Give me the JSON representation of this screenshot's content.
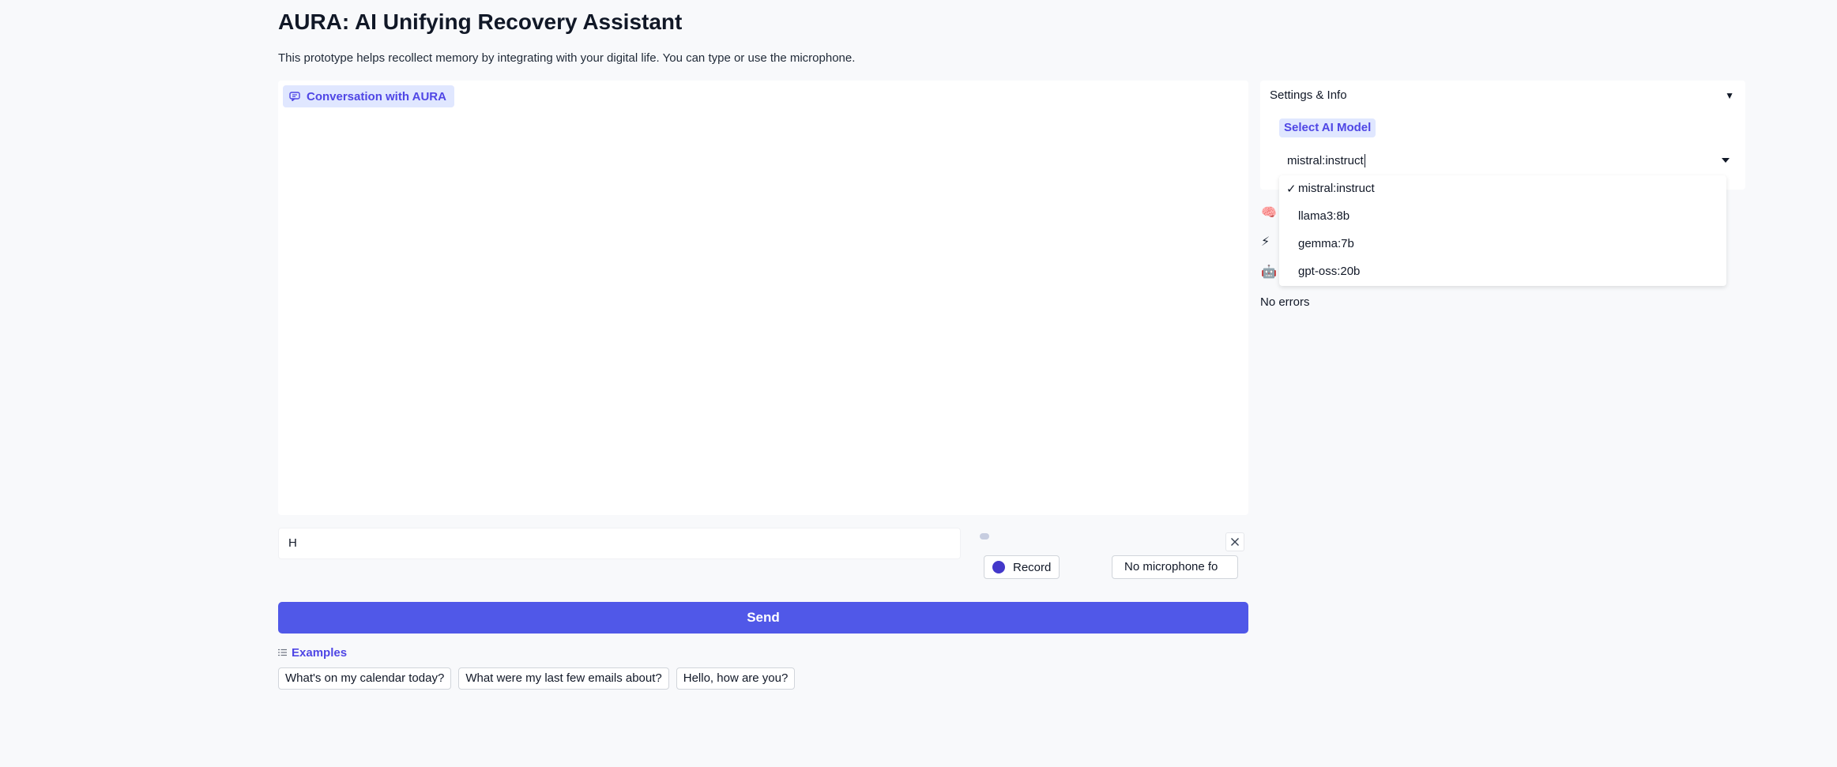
{
  "header": {
    "title": "AURA: AI Unifying Recovery Assistant",
    "description": "This prototype helps recollect memory by integrating with your digital life. You can type or use the microphone."
  },
  "chat": {
    "label": "Conversation with AURA",
    "icon": "chat-bubble-icon"
  },
  "input": {
    "value": "H"
  },
  "audio": {
    "record_label": "Record",
    "mic_select_value": "No microphone fo"
  },
  "send": {
    "label": "Send"
  },
  "examples": {
    "label": "Examples",
    "items": [
      "What's on my calendar today?",
      "What were my last few emails about?",
      "Hello, how are you?"
    ]
  },
  "settings": {
    "header": "Settings & Info",
    "toggle": "▼",
    "model_label": "Select AI Model",
    "model_value": "mistral:instruct",
    "options": [
      "mistral:instruct",
      "llama3:8b",
      "gemma:7b",
      "gpt-oss:20b"
    ],
    "selected_mark": "✓"
  },
  "status": {
    "icons": [
      "brain-icon",
      "lightning-icon",
      "robot-icon"
    ],
    "errors": "No errors"
  },
  "colors": {
    "accent": "#5058e8",
    "label_bg": "#e0e7ff",
    "label_text": "#4f46e5"
  }
}
